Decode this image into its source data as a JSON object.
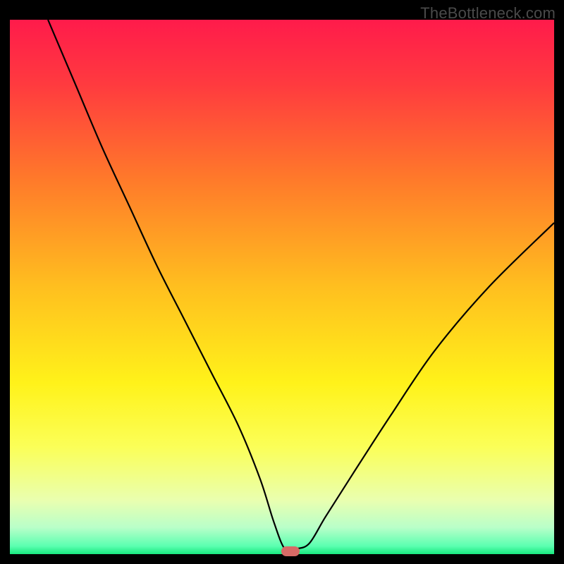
{
  "watermark": "TheBottleneck.com",
  "chart_data": {
    "type": "line",
    "title": "",
    "xlabel": "",
    "ylabel": "",
    "xlim": [
      0,
      100
    ],
    "ylim": [
      0,
      100
    ],
    "background": {
      "type": "vertical-gradient",
      "stops": [
        {
          "offset": 0.0,
          "color": "#ff1b4b"
        },
        {
          "offset": 0.12,
          "color": "#ff3a3f"
        },
        {
          "offset": 0.3,
          "color": "#ff7a2a"
        },
        {
          "offset": 0.5,
          "color": "#ffbf1f"
        },
        {
          "offset": 0.68,
          "color": "#fff21a"
        },
        {
          "offset": 0.8,
          "color": "#fbff58"
        },
        {
          "offset": 0.9,
          "color": "#e9ffb0"
        },
        {
          "offset": 0.95,
          "color": "#b9ffc9"
        },
        {
          "offset": 0.985,
          "color": "#5bffb0"
        },
        {
          "offset": 1.0,
          "color": "#18e87f"
        }
      ]
    },
    "series": [
      {
        "name": "bottleneck-curve",
        "color": "#000000",
        "x": [
          7,
          12,
          17,
          22,
          27,
          32,
          37,
          42,
          46,
          48.5,
          50.5,
          52.5,
          55,
          58,
          63,
          70,
          78,
          88,
          100
        ],
        "values": [
          100,
          88,
          76,
          65,
          54,
          44,
          34,
          24,
          14,
          6,
          1,
          1,
          2,
          7,
          15,
          26,
          38,
          50,
          62
        ]
      }
    ],
    "marker": {
      "x": 51.5,
      "y": 0,
      "color": "#d76a66"
    },
    "grid": false,
    "legend": false
  }
}
